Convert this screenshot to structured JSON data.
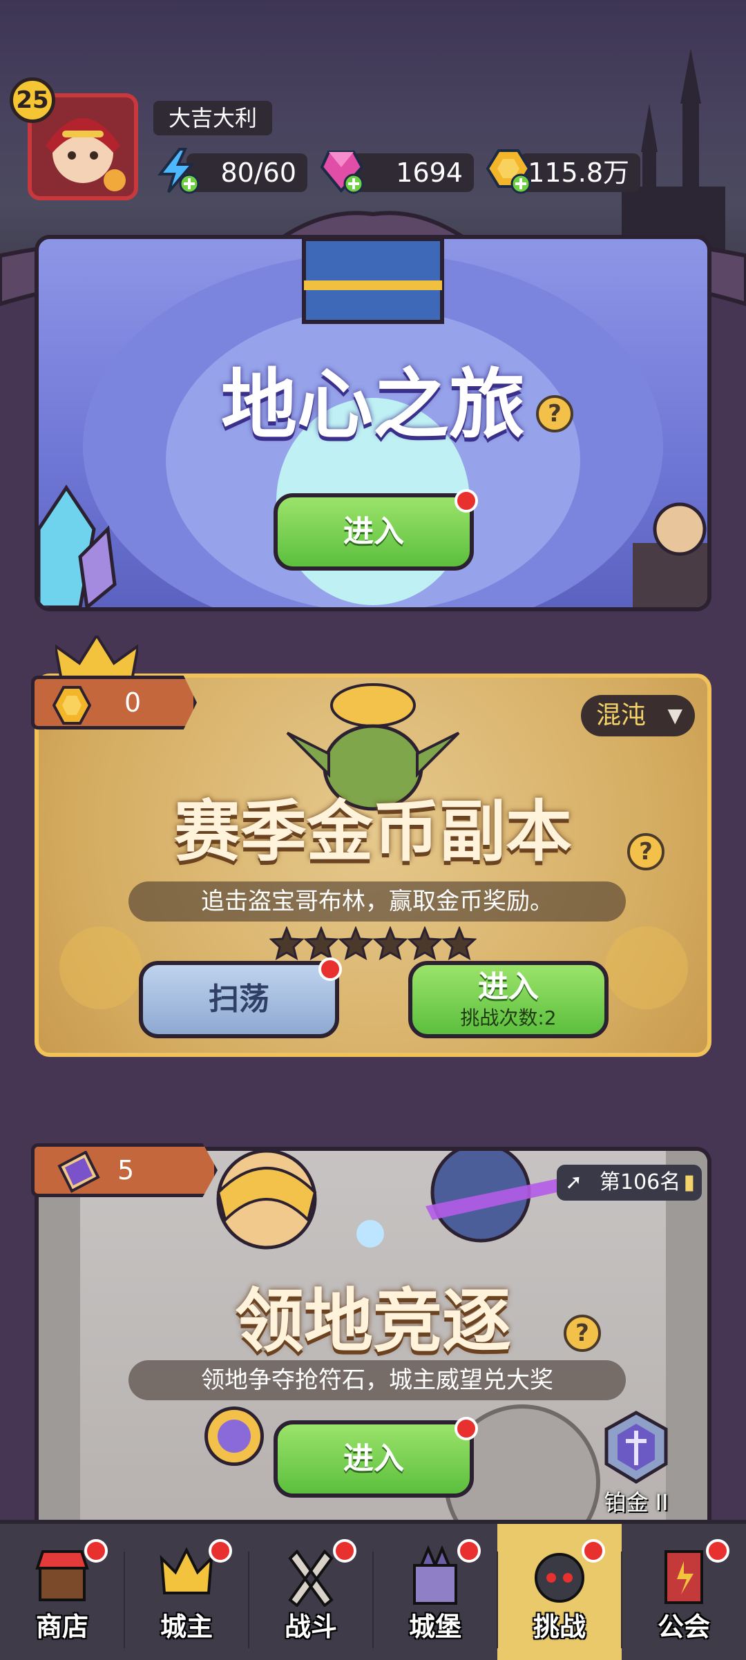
{
  "player": {
    "level": "25",
    "name": "大吉大利",
    "energy": "80/60",
    "gems": "1694",
    "gold": "115.8万"
  },
  "journey": {
    "title": "地心之旅",
    "help": "?",
    "enter_label": "进入"
  },
  "season_coin": {
    "coin_count": "0",
    "mode": "混沌",
    "title": "赛季金币副本",
    "help": "?",
    "description": "追击盗宝哥布林，赢取金币奖励。",
    "stars": 6,
    "sweep_label": "扫荡",
    "enter_label": "进入",
    "challenge_count": "挑战次数:2"
  },
  "territory": {
    "ticket_count": "5",
    "rank": "第106名",
    "title": "领地竞逐",
    "help": "?",
    "description": "领地争夺抢符石，城主威望兑大奖",
    "enter_label": "进入",
    "tier": "铂金 II"
  },
  "nav": {
    "items": [
      {
        "label": "商店"
      },
      {
        "label": "城主"
      },
      {
        "label": "战斗"
      },
      {
        "label": "城堡"
      },
      {
        "label": "挑战"
      },
      {
        "label": "公会"
      }
    ]
  },
  "colors": {
    "accent_green": "#6fd045",
    "badge_red": "#e8302f",
    "nav_active": "#e9c96a"
  }
}
